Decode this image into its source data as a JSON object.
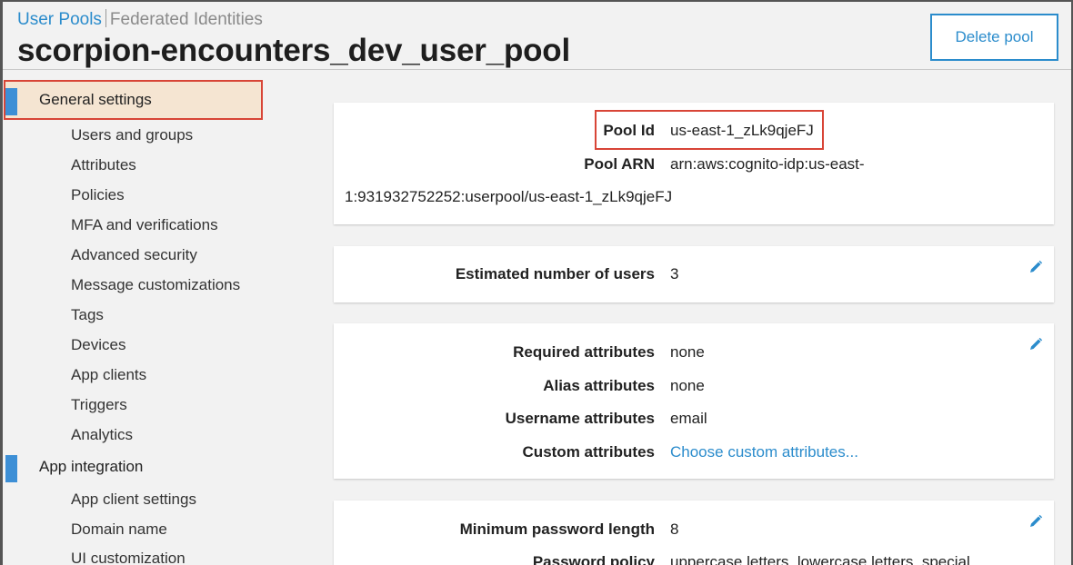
{
  "breadcrumbs": {
    "active": "User Pools",
    "inactive": "Federated Identities"
  },
  "page": {
    "title": "scorpion-encounters_dev_user_pool",
    "delete_button": "Delete pool"
  },
  "sidebar": {
    "general": {
      "label": "General settings",
      "items": [
        "Users and groups",
        "Attributes",
        "Policies",
        "MFA and verifications",
        "Advanced security",
        "Message customizations",
        "Tags",
        "Devices",
        "App clients",
        "Triggers",
        "Analytics"
      ]
    },
    "app_integration": {
      "label": "App integration",
      "items": [
        "App client settings",
        "Domain name",
        "UI customization"
      ]
    }
  },
  "pool_info": {
    "pool_id_label": "Pool Id",
    "pool_id_value": "us-east-1_zLk9qjeFJ",
    "pool_arn_label": "Pool ARN",
    "pool_arn_value_line1": "arn:aws:cognito-idp:us-east-",
    "pool_arn_value_line2": "1:931932752252:userpool/us-east-1_zLk9qjeFJ"
  },
  "users": {
    "label": "Estimated number of users",
    "value": "3"
  },
  "attributes": {
    "required_label": "Required attributes",
    "required_value": "none",
    "alias_label": "Alias attributes",
    "alias_value": "none",
    "username_label": "Username attributes",
    "username_value": "email",
    "custom_label": "Custom attributes",
    "custom_value": "Choose custom attributes..."
  },
  "password": {
    "min_length_label": "Minimum password length",
    "min_length_value": "8",
    "policy_label": "Password policy",
    "policy_value": "uppercase letters, lowercase letters, special"
  },
  "colors": {
    "accent": "#2b8ccc",
    "highlight_border": "#d84537",
    "selected_bg": "#f5e5d2",
    "section_bar": "#3d8fd6"
  },
  "icons": {
    "edit": "pencil-icon"
  }
}
